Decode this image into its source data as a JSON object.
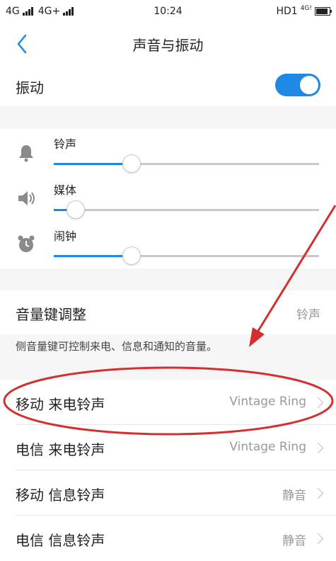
{
  "status": {
    "left": "4G .ıl 4G+ .ıl",
    "net1": "4G",
    "net2": "4G+",
    "time": "10:24",
    "right": "HD1",
    "right_sup": "4G!"
  },
  "nav": {
    "title": "声音与振动"
  },
  "vibration": {
    "label": "振动",
    "on": true
  },
  "volumes": [
    {
      "label": "铃声",
      "icon": "bell-icon",
      "level": 0.29
    },
    {
      "label": "媒体",
      "icon": "speaker-icon",
      "level": 0.08
    },
    {
      "label": "闹钟",
      "icon": "alarm-clock-icon",
      "level": 0.29
    }
  ],
  "volume_key": {
    "label": "音量键调整",
    "value": "铃声"
  },
  "note": "侧音量键可控制来电、信息和通知的音量。",
  "ringtones": [
    {
      "label": "移动 来电铃声",
      "value": "Vintage Ring"
    },
    {
      "label": "电信 来电铃声",
      "value": "Vintage Ring"
    },
    {
      "label": "移动 信息铃声",
      "value": "静音"
    },
    {
      "label": "电信 信息铃声",
      "value": "静音"
    }
  ],
  "colors": {
    "accent": "#1e88e5",
    "annotation": "#d32f2f"
  }
}
